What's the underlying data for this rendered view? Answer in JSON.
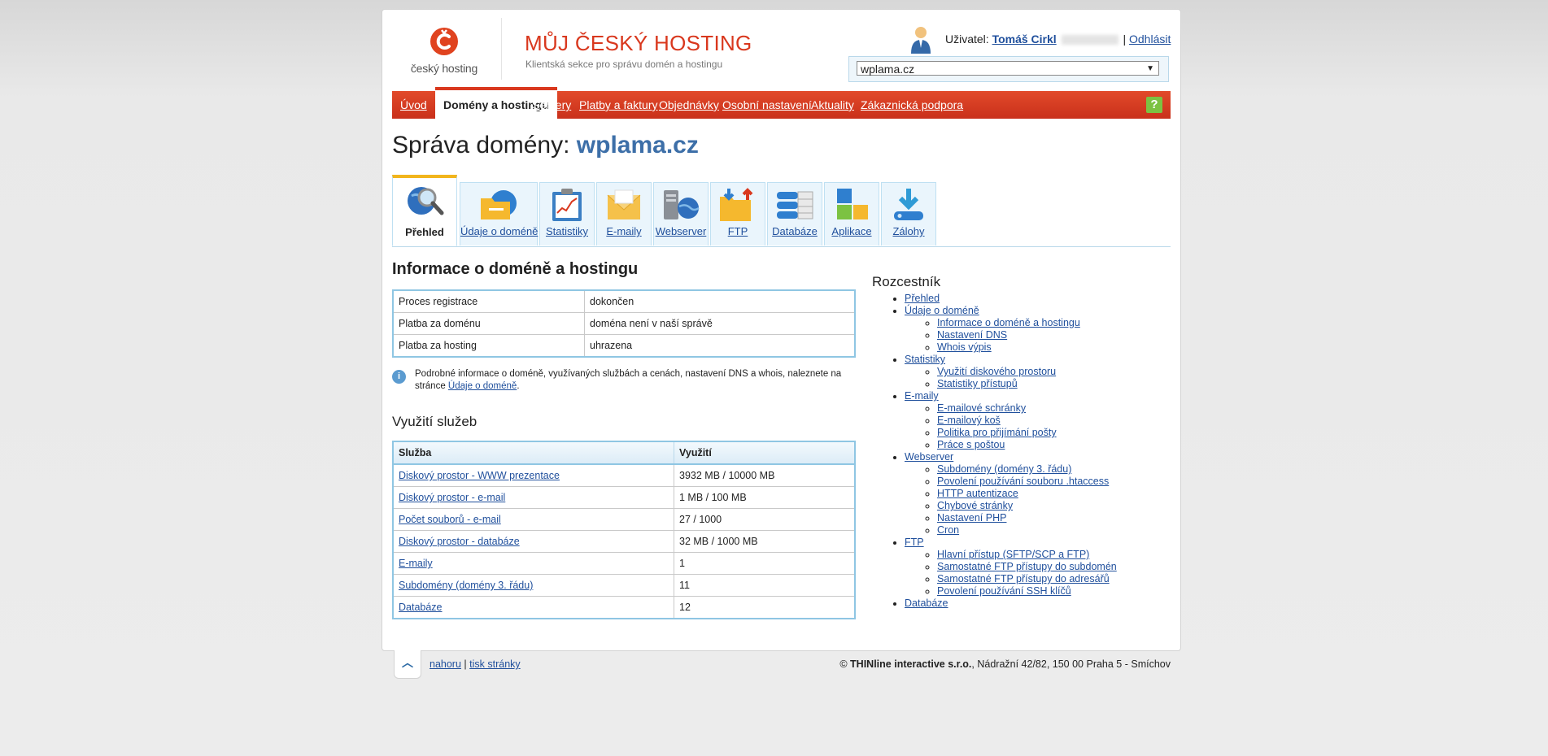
{
  "header": {
    "logo_text": "český hosting",
    "brand_title": "MŮJ ČESKÝ HOSTING",
    "brand_subtitle": "Klientská sekce pro správu domén a hostingu",
    "user_label": "Uživatel:",
    "user_name": "Tomáš Cirkl",
    "separator": "|",
    "logout": "Odhlásit",
    "domain_selected": "wplama.cz"
  },
  "nav": {
    "items": [
      "Úvod",
      "Domény a hostingu",
      "Servery",
      "Platby a faktury",
      "Objednávky",
      "Osobní nastavení",
      "Aktuality",
      "Zákaznická podpora"
    ],
    "help": "?"
  },
  "title": {
    "prefix": "Správa domény:",
    "domain": "wplama.cz"
  },
  "tabs": [
    "Přehled",
    "Údaje o doméně",
    "Statistiky",
    "E-maily",
    "Webserver",
    "FTP",
    "Databáze",
    "Aplikace",
    "Zálohy"
  ],
  "info": {
    "heading": "Informace o doméně a hostingu",
    "rows": [
      {
        "label": "Proces registrace",
        "value": "dokončen"
      },
      {
        "label": "Platba za doménu",
        "value": "doména není v naší správě"
      },
      {
        "label": "Platba za hosting",
        "value": "uhrazena"
      }
    ],
    "note": "Podrobné informace o doméně, využívaných službách a cenách, nastavení DNS a whois, naleznete na stránce",
    "note_link": "Údaje o doméně",
    "note_end": "."
  },
  "usage": {
    "heading": "Využití služeb",
    "col_service": "Služba",
    "col_usage": "Využití",
    "rows": [
      {
        "service": "Diskový prostor - WWW prezentace",
        "value": "3932 MB / 10000 MB"
      },
      {
        "service": "Diskový prostor - e-mail",
        "value": "1 MB / 100 MB"
      },
      {
        "service": "Počet souborů - e-mail",
        "value": "27 / 1000"
      },
      {
        "service": "Diskový prostor - databáze",
        "value": "32 MB / 1000 MB"
      },
      {
        "service": "E-maily",
        "value": "1"
      },
      {
        "service": "Subdomény (domény 3. řádu)",
        "value": "11"
      },
      {
        "service": "Databáze",
        "value": "12"
      }
    ]
  },
  "rozcestnik": {
    "heading": "Rozcestník",
    "groups": [
      {
        "label": "Přehled",
        "children": []
      },
      {
        "label": "Údaje o doméně",
        "children": [
          "Informace o doméně a hostingu",
          "Nastavení DNS",
          "Whois výpis"
        ]
      },
      {
        "label": "Statistiky",
        "children": [
          "Využití diskového prostoru",
          "Statistiky přístupů"
        ]
      },
      {
        "label": "E-maily",
        "children": [
          "E-mailové schránky",
          "E-mailový koš",
          "Politika pro přijímání pošty",
          "Práce s poštou"
        ]
      },
      {
        "label": "Webserver",
        "children": [
          "Subdomény (domény 3. řádu)",
          "Povolení používání souboru .htaccess",
          "HTTP autentizace",
          "Chybové stránky",
          "Nastavení PHP",
          "Cron"
        ]
      },
      {
        "label": "FTP",
        "children": [
          "Hlavní přístup (SFTP/SCP a FTP)",
          "Samostatné FTP přístupy do subdomén",
          "Samostatné FTP přístupy do adresářů",
          "Povolení používání SSH klíčů"
        ]
      },
      {
        "label": "Databáze",
        "children": []
      }
    ]
  },
  "footer": {
    "top_link": "nahoru",
    "print_link": "tisk stránky",
    "separator": "|",
    "copyright_prefix": "©",
    "company": "THINline interactive s.r.o.",
    "address": ", Nádražní 42/82, 150 00 Praha 5 - Smíchov"
  },
  "colors": {
    "accent_red": "#d9381e",
    "link_blue": "#1f4f9c",
    "tab_bg": "#eaf5fc",
    "active_tab_border": "#f2b51c",
    "help_green": "#7cc242"
  }
}
